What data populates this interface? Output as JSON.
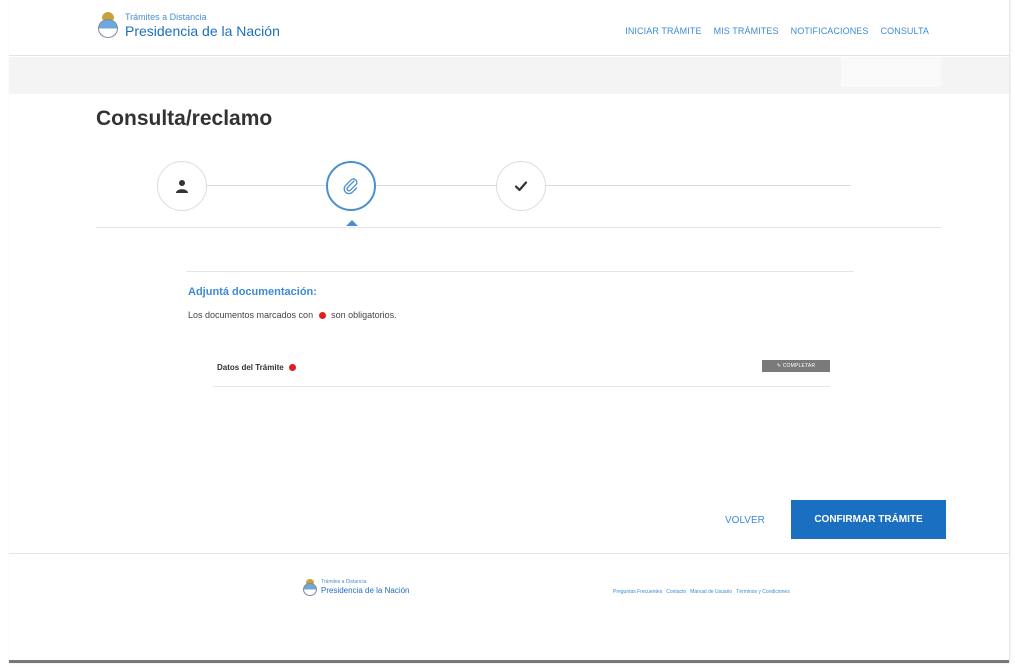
{
  "header": {
    "logo_small": "Trámites a Distancia",
    "logo_big": "Presidencia de la Nación",
    "nav": [
      {
        "label": "INICIAR TRÁMITE"
      },
      {
        "label": "MIS TRÁMITES"
      },
      {
        "label": "NOTIFICACIONES"
      },
      {
        "label": "CONSULTA"
      }
    ]
  },
  "page": {
    "title": "Consulta/reclamo"
  },
  "stepper": {
    "steps": [
      {
        "icon": "user-icon",
        "state": "done"
      },
      {
        "icon": "paperclip-icon",
        "state": "active"
      },
      {
        "icon": "check-icon",
        "state": "pending"
      }
    ]
  },
  "content": {
    "section_title": "Adjuntá documentación:",
    "desc_prefix": "Los documentos marcados con",
    "desc_suffix": "son obligatorios.",
    "documents": [
      {
        "label": "Datos del Trámite",
        "required": true,
        "button_label": "✎ COMPLETAR"
      }
    ]
  },
  "actions": {
    "back_label": "VOLVER",
    "confirm_label": "CONFIRMAR TRÁMITE"
  },
  "footer": {
    "logo_small": "Trámites a Distancia",
    "logo_big": "Presidencia de la Nación",
    "links": [
      {
        "label": "Preguntas Frecuentes"
      },
      {
        "label": "Contacto"
      },
      {
        "label": "Manual de Usuario"
      },
      {
        "label": "Términos y Condiciones"
      }
    ]
  },
  "colors": {
    "primary": "#1b6fc0",
    "link": "#3b8bd6",
    "required": "#e31b23",
    "button_gray": "#7a7a7a"
  }
}
